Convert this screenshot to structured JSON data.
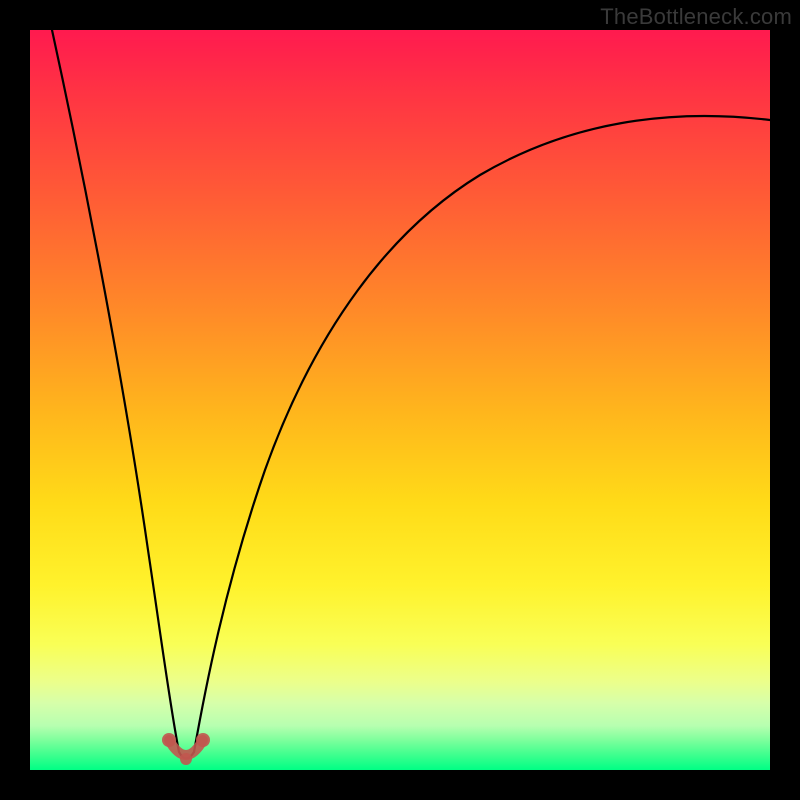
{
  "watermark": "TheBottleneck.com",
  "colors": {
    "frame": "#000000",
    "curve": "#000000",
    "marker": "#c1564f"
  },
  "chart_data": {
    "type": "line",
    "title": "",
    "xlabel": "",
    "ylabel": "",
    "xlim": [
      0,
      100
    ],
    "ylim": [
      0,
      100
    ],
    "grid": false,
    "legend": false,
    "notes": "Normalized 0–100 axes estimated from pixel positions. Bottleneck-style V curve where y≈0 is ideal (green) and y≈100 is worst (red). Minimum near x≈20.",
    "series": [
      {
        "name": "left-branch",
        "x": [
          3,
          6,
          9,
          12,
          15,
          17,
          18.5,
          19.5
        ],
        "y": [
          100,
          78,
          57,
          38,
          21,
          9,
          3,
          0.5
        ]
      },
      {
        "name": "right-branch",
        "x": [
          22,
          24,
          27,
          31,
          36,
          42,
          50,
          60,
          72,
          85,
          100
        ],
        "y": [
          1,
          6,
          15,
          27,
          40,
          52,
          63,
          72,
          79,
          84,
          88
        ]
      },
      {
        "name": "optimum-marker",
        "x": [
          18.5,
          20,
          22.5
        ],
        "y": [
          2,
          0,
          2
        ]
      }
    ]
  }
}
